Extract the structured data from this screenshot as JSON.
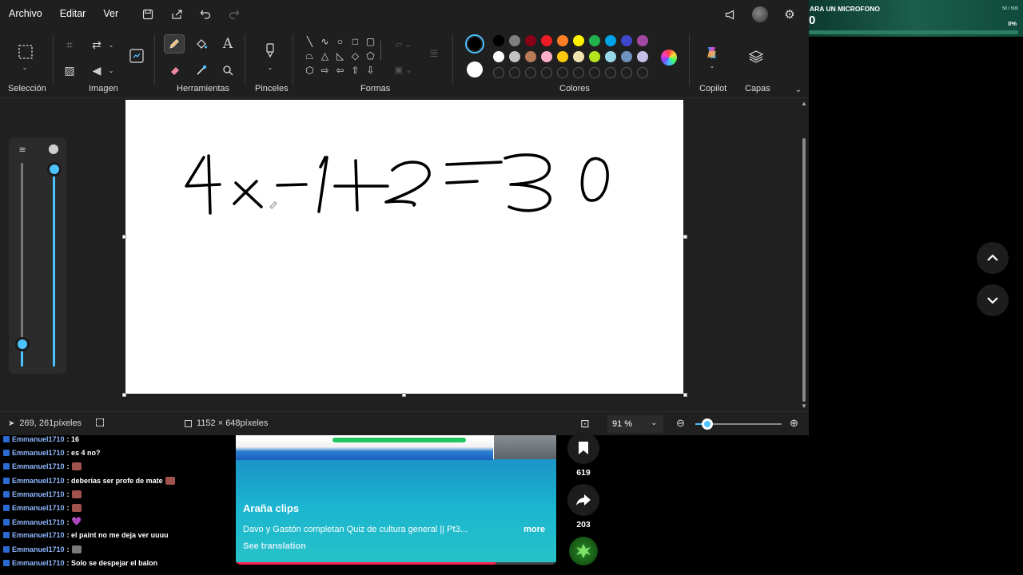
{
  "menubar": {
    "items": [
      "Archivo",
      "Editar",
      "Ver"
    ]
  },
  "ribbon": {
    "groups": {
      "seleccion": "Selección",
      "imagen": "Imagen",
      "herramientas": "Herramientas",
      "pinceles": "Pinceles",
      "formas": "Formas",
      "colores": "Colores",
      "copilot": "Copilot",
      "capas": "Capas"
    },
    "palette_row1": [
      "#000000",
      "#7f7f7f",
      "#880015",
      "#ed1c24",
      "#ff7f27",
      "#fff200",
      "#22b14c",
      "#00a2e8",
      "#3f48cc",
      "#a349a4"
    ],
    "palette_row2": [
      "#ffffff",
      "#c3c3c3",
      "#b97a57",
      "#ffaec9",
      "#ffc90e",
      "#efe4b0",
      "#b5e61d",
      "#99d9ea",
      "#7092be",
      "#c8bfe7"
    ],
    "color1": "#000000",
    "color2": "#ffffff"
  },
  "canvas": {
    "equation_image": "4x - 1 + 2 = 30 handwritten"
  },
  "status": {
    "cursor_pos": "269, 261píxeles",
    "image_size": "1152 × 648píxeles",
    "zoom": "91 %"
  },
  "mic_overlay": {
    "title": "ARA UN MICROFONO",
    "count": "0",
    "small": "50 / 500",
    "percent": "0%"
  },
  "chat": {
    "messages": [
      {
        "user": "Emmanuel1710",
        "text": ": 16",
        "emote": ""
      },
      {
        "user": "Emmanuel1710",
        "text": ": es 4 no?",
        "emote": ""
      },
      {
        "user": "Emmanuel1710",
        "text": ":",
        "emote": "brown"
      },
      {
        "user": "Emmanuel1710",
        "text": ": deberías ser profe de mate",
        "emote": "brown"
      },
      {
        "user": "Emmanuel1710",
        "text": ":",
        "emote": "brown"
      },
      {
        "user": "Emmanuel1710",
        "text": ":",
        "emote": "brown"
      },
      {
        "user": "Emmanuel1710",
        "text": ":",
        "emote": "purple"
      },
      {
        "user": "Emmanuel1710",
        "text": ": el paint no me deja ver uuuu",
        "emote": ""
      },
      {
        "user": "Emmanuel1710",
        "text": ":",
        "emote": "grey"
      },
      {
        "user": "Emmanuel1710",
        "text": ": Solo se despejar el balon",
        "emote": ""
      }
    ]
  },
  "video": {
    "channel": "Araña clips",
    "title": "Davo y Gastón completan Quiz de cultura general || Pt3...",
    "more": "more",
    "translate": "See translation",
    "progress_fraction": 0.81
  },
  "actions": {
    "save_count": "619",
    "share_count": "203"
  },
  "icons": {
    "save": "bookmark-icon",
    "share": "share-icon",
    "up": "chevron-up-icon",
    "down": "chevron-down-icon"
  }
}
